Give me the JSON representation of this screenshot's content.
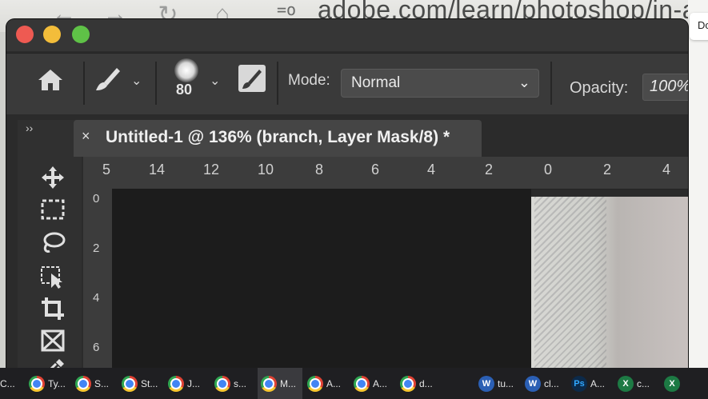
{
  "browser": {
    "url": "adobe.com/learn/photoshop/in-app",
    "side_chip": "Do"
  },
  "colors": {
    "close": "#ee5a52",
    "minimize": "#f3bd3a",
    "zoom": "#5fc247",
    "ps_bg": "#2b2b2b"
  },
  "options_bar": {
    "brush_size": "80",
    "mode_label": "Mode:",
    "mode_value": "Normal",
    "opacity_label": "Opacity:",
    "opacity_value": "100%"
  },
  "document_tab": {
    "close": "×",
    "title": "Untitled-1 @ 136% (branch, Layer Mask/8) *"
  },
  "toolbar": {
    "collapse": "››",
    "tools": [
      "move-tool",
      "marquee-tool",
      "lasso-tool",
      "object-selection-tool",
      "crop-tool",
      "frame-tool",
      "eyedropper-tool"
    ]
  },
  "ruler_top": [
    "5",
    "14",
    "12",
    "10",
    "8",
    "6",
    "4",
    "2",
    "0",
    "2",
    "4"
  ],
  "ruler_left": [
    "0",
    "2",
    "4",
    "6"
  ],
  "taskbar": [
    {
      "icon": "chrome-icon",
      "label": "C..."
    },
    {
      "icon": "chrome-icon",
      "label": "Ty..."
    },
    {
      "icon": "chrome-icon",
      "label": "S..."
    },
    {
      "icon": "chrome-icon",
      "label": "St..."
    },
    {
      "icon": "chrome-icon",
      "label": "J..."
    },
    {
      "icon": "chrome-icon",
      "label": "s..."
    },
    {
      "icon": "chrome-icon",
      "label": "M..."
    },
    {
      "icon": "chrome-icon",
      "label": "A..."
    },
    {
      "icon": "chrome-icon",
      "label": "A..."
    },
    {
      "icon": "chrome-icon",
      "label": "d..."
    },
    {
      "icon": "word-icon",
      "label": "tu..."
    },
    {
      "icon": "word-icon",
      "label": "cl..."
    },
    {
      "icon": "photoshop-icon",
      "label": "A..."
    },
    {
      "icon": "excel-icon",
      "label": "c..."
    },
    {
      "icon": "excel-icon",
      "label": ""
    }
  ]
}
